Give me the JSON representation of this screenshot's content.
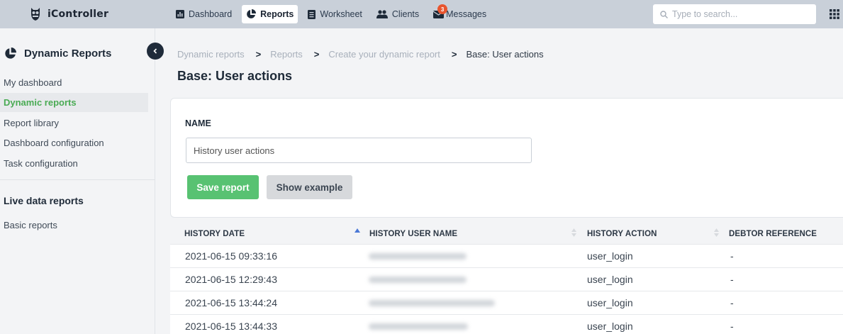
{
  "app": {
    "name": "iController"
  },
  "nav": {
    "items": [
      {
        "label": "Dashboard",
        "icon": "dashboard-icon"
      },
      {
        "label": "Reports",
        "icon": "pie-chart-icon",
        "active": true
      },
      {
        "label": "Worksheet",
        "icon": "document-icon"
      },
      {
        "label": "Clients",
        "icon": "users-icon"
      },
      {
        "label": "Messages",
        "icon": "envelope-icon",
        "badge": "3"
      }
    ],
    "search_placeholder": "Type to search..."
  },
  "sidebar": {
    "title": "Dynamic Reports",
    "items": [
      {
        "label": "My dashboard"
      },
      {
        "label": "Dynamic reports",
        "active": true
      },
      {
        "label": "Report library"
      },
      {
        "label": "Dashboard configuration"
      },
      {
        "label": "Task configuration"
      }
    ],
    "section_title": "Live data reports",
    "section_items": [
      {
        "label": "Basic reports"
      }
    ]
  },
  "breadcrumb": [
    "Dynamic reports",
    "Reports",
    "Create your dynamic report",
    "Base: User actions"
  ],
  "page_title": "Base: User actions",
  "form": {
    "name_label": "NAME",
    "name_value": "History user actions",
    "save_label": "Save report",
    "example_label": "Show example"
  },
  "table": {
    "columns": [
      "HISTORY DATE",
      "HISTORY USER NAME",
      "HISTORY ACTION",
      "DEBTOR REFERENCE"
    ],
    "rows": [
      {
        "date": "2021-06-15 09:33:16",
        "action": "user_login",
        "debtor": "-"
      },
      {
        "date": "2021-06-15 12:29:43",
        "action": "user_login",
        "debtor": "-"
      },
      {
        "date": "2021-06-15 13:44:24",
        "action": "user_login",
        "debtor": "-"
      },
      {
        "date": "2021-06-15 13:44:33",
        "action": "user_login",
        "debtor": "-"
      }
    ]
  },
  "colors": {
    "topbar": "#c9d0d9",
    "accent_green": "#58c272",
    "active_text": "#4aab54",
    "badge": "#e8552f",
    "dark": "#1e2a38"
  }
}
